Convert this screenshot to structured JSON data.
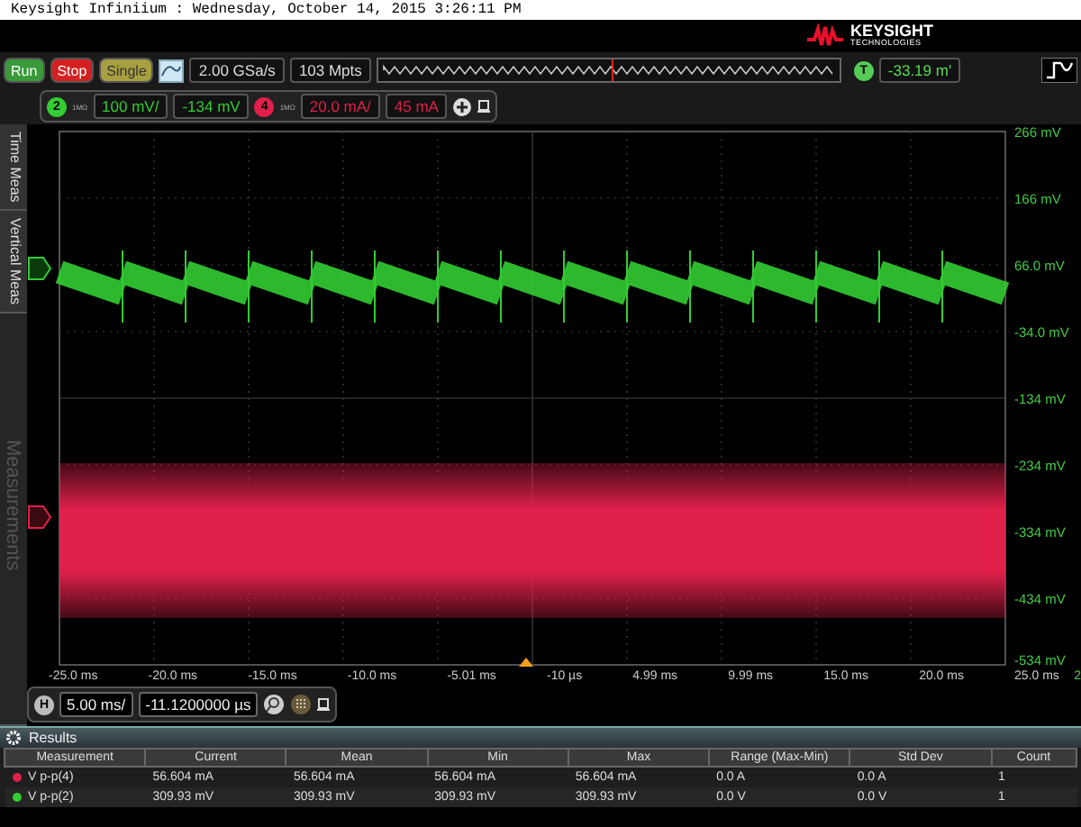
{
  "title_bar": {
    "text": "Keysight Infiniium : Wednesday, October 14, 2015 3:26:11 PM"
  },
  "logo": {
    "name": "KEYSIGHT",
    "subtitle": "TECHNOLOGIES"
  },
  "acquisition": {
    "buttons": [
      {
        "label": "Run",
        "kind": "run"
      },
      {
        "label": "Stop",
        "kind": "stop"
      },
      {
        "label": "Single",
        "kind": "single"
      }
    ],
    "sample_rate": "2.00 GSa/s",
    "memory_depth": "103 Mpts"
  },
  "trigger": {
    "badge": "T",
    "value": "-33.19 m'"
  },
  "channels": [
    {
      "number": "2",
      "impedance": "1MΩ",
      "scale": "100 mV/",
      "offset": "-134 mV",
      "color": "#33cc33"
    },
    {
      "number": "4",
      "impedance": "1MΩ",
      "scale": "20.0 mA/",
      "offset": "45 mA",
      "color": "#e0204a"
    }
  ],
  "side_tabs": [
    {
      "label": "Time Meas",
      "disabled": false
    },
    {
      "label": "Vertical Meas",
      "disabled": false
    },
    {
      "label": "Measurements",
      "disabled": true
    }
  ],
  "plot": {
    "y_labels": [
      "266 mV",
      "166 mV",
      "66.0 mV",
      "-34.0 mV",
      "-134 mV",
      "-234 mV",
      "-334 mV",
      "-434 mV",
      "-534 mV"
    ],
    "x_labels": [
      "-25.0 ms",
      "-20.0 ms",
      "-15.0 ms",
      "-10.0 ms",
      "-5.01 ms",
      "-10 µs",
      "4.99 ms",
      "9.99 ms",
      "15.0 ms",
      "20.0 ms",
      "25.0 ms"
    ],
    "corner_label": "2"
  },
  "timebase": {
    "badge": "H",
    "scale": "5.00 ms/",
    "position": "-11.1200000 µs"
  },
  "results": {
    "title": "Results",
    "columns": [
      "Measurement",
      "Current",
      "Mean",
      "Min",
      "Max",
      "Range (Max-Min)",
      "Std Dev",
      "Count"
    ],
    "rows": [
      {
        "color": "#e0204a",
        "cells": [
          "V p-p(4)",
          "56.604 mA",
          "56.604 mA",
          "56.604 mA",
          "56.604 mA",
          "0.0 A",
          "0.0 A",
          "1"
        ]
      },
      {
        "color": "#33cc33",
        "cells": [
          "V p-p(2)",
          "309.93 mV",
          "309.93 mV",
          "309.93 mV",
          "309.93 mV",
          "0.0 V",
          "0.0 V",
          "1"
        ]
      }
    ]
  }
}
